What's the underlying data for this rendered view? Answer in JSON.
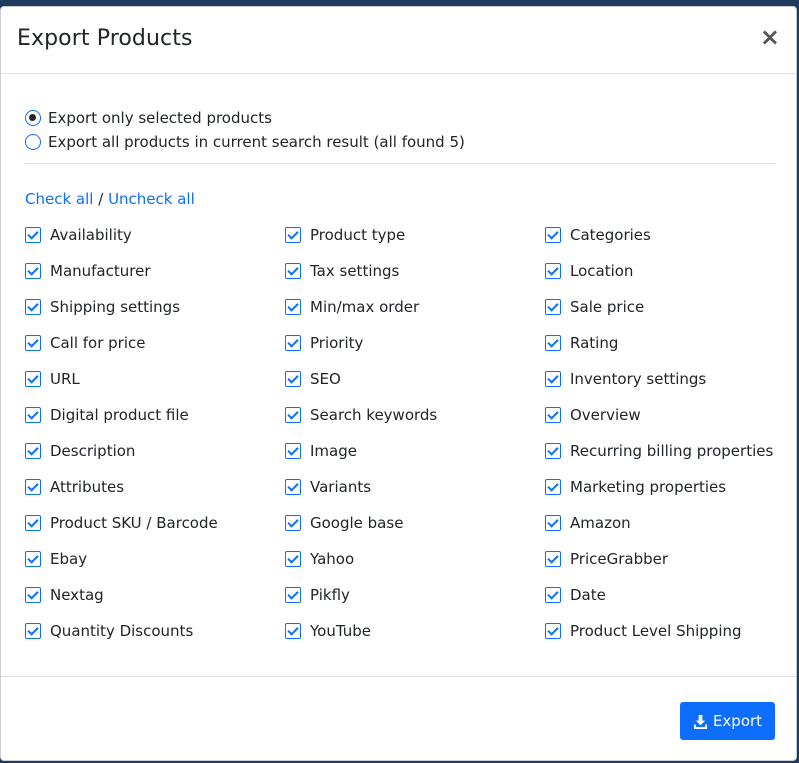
{
  "modal": {
    "title": "Export Products",
    "close_glyph": "×"
  },
  "scope": {
    "options": [
      {
        "label": "Export only selected products",
        "selected": true
      },
      {
        "label": "Export all products in current search result (all found 5)",
        "selected": false
      }
    ]
  },
  "bulk": {
    "check_all": "Check all",
    "separator": "/",
    "uncheck_all": "Uncheck all"
  },
  "fields": {
    "columns": [
      [
        {
          "label": "Availability",
          "checked": true
        },
        {
          "label": "Manufacturer",
          "checked": true
        },
        {
          "label": "Shipping settings",
          "checked": true
        },
        {
          "label": "Call for price",
          "checked": true
        },
        {
          "label": "URL",
          "checked": true
        },
        {
          "label": "Digital product file",
          "checked": true
        },
        {
          "label": "Description",
          "checked": true
        },
        {
          "label": "Attributes",
          "checked": true
        },
        {
          "label": "Product SKU / Barcode",
          "checked": true
        },
        {
          "label": "Ebay",
          "checked": true
        },
        {
          "label": "Nextag",
          "checked": true
        },
        {
          "label": "Quantity Discounts",
          "checked": true
        }
      ],
      [
        {
          "label": "Product type",
          "checked": true
        },
        {
          "label": "Tax settings",
          "checked": true
        },
        {
          "label": "Min/max order",
          "checked": true
        },
        {
          "label": "Priority",
          "checked": true
        },
        {
          "label": "SEO",
          "checked": true
        },
        {
          "label": "Search keywords",
          "checked": true
        },
        {
          "label": "Image",
          "checked": true
        },
        {
          "label": "Variants",
          "checked": true
        },
        {
          "label": "Google base",
          "checked": true
        },
        {
          "label": "Yahoo",
          "checked": true
        },
        {
          "label": "Pikfly",
          "checked": true
        },
        {
          "label": "YouTube",
          "checked": true
        }
      ],
      [
        {
          "label": "Categories",
          "checked": true
        },
        {
          "label": "Location",
          "checked": true
        },
        {
          "label": "Sale price",
          "checked": true
        },
        {
          "label": "Rating",
          "checked": true
        },
        {
          "label": "Inventory settings",
          "checked": true
        },
        {
          "label": "Overview",
          "checked": true
        },
        {
          "label": "Recurring billing properties",
          "checked": true
        },
        {
          "label": "Marketing properties",
          "checked": true
        },
        {
          "label": "Amazon",
          "checked": true
        },
        {
          "label": "PriceGrabber",
          "checked": true
        },
        {
          "label": "Date",
          "checked": true
        },
        {
          "label": "Product Level Shipping",
          "checked": true
        }
      ]
    ]
  },
  "footer": {
    "export_label": "Export",
    "export_icon": "download-icon",
    "button_color": "#0d6efd"
  }
}
